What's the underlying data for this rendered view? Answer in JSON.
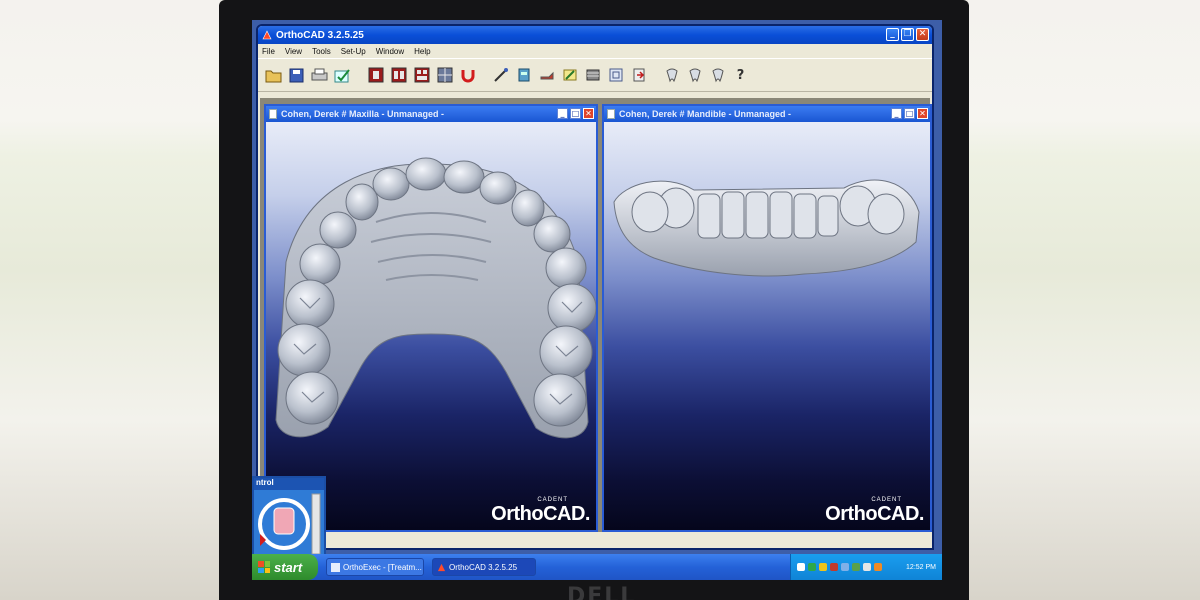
{
  "app": {
    "title": "OrthoCAD 3.2.5.25",
    "menu": [
      "File",
      "View",
      "Tools",
      "Set-Up",
      "Window",
      "Help"
    ]
  },
  "toolbar": {
    "icons": [
      "open-folder-icon",
      "save-icon",
      "print-icon",
      "check-icon",
      "layout-1-icon",
      "layout-2-icon",
      "layout-3-icon",
      "layout-4-icon",
      "magnet-icon",
      "measure-icon",
      "model-icon",
      "bolt-icon",
      "edit-icon",
      "table-icon",
      "segment-icon",
      "export-icon",
      "tooth-1-icon",
      "tooth-2-icon",
      "tooth-3-icon",
      "help-icon"
    ]
  },
  "windows": {
    "maxilla": {
      "title": "Cohen, Derek  # Maxilla - Unmanaged -"
    },
    "mandible": {
      "title": "Cohen, Derek  # Mandible - Unmanaged -"
    }
  },
  "watermark": {
    "brand_small": "CADENT",
    "brand_big": "OrthoCAD."
  },
  "side_widget": {
    "title": "ntrol"
  },
  "taskbar": {
    "start": "start",
    "items": [
      "OrthoExec - [Treatm...",
      "OrthoCAD 3.2.5.25"
    ],
    "clock": "12:52 PM"
  },
  "monitor": {
    "brand": "DELL"
  },
  "colors": {
    "titlebar": "#0a4fd8",
    "taskbar": "#2462d8",
    "start": "#2e8b2c",
    "viewport_top": "#e8ecf8",
    "viewport_bottom": "#05061c"
  }
}
